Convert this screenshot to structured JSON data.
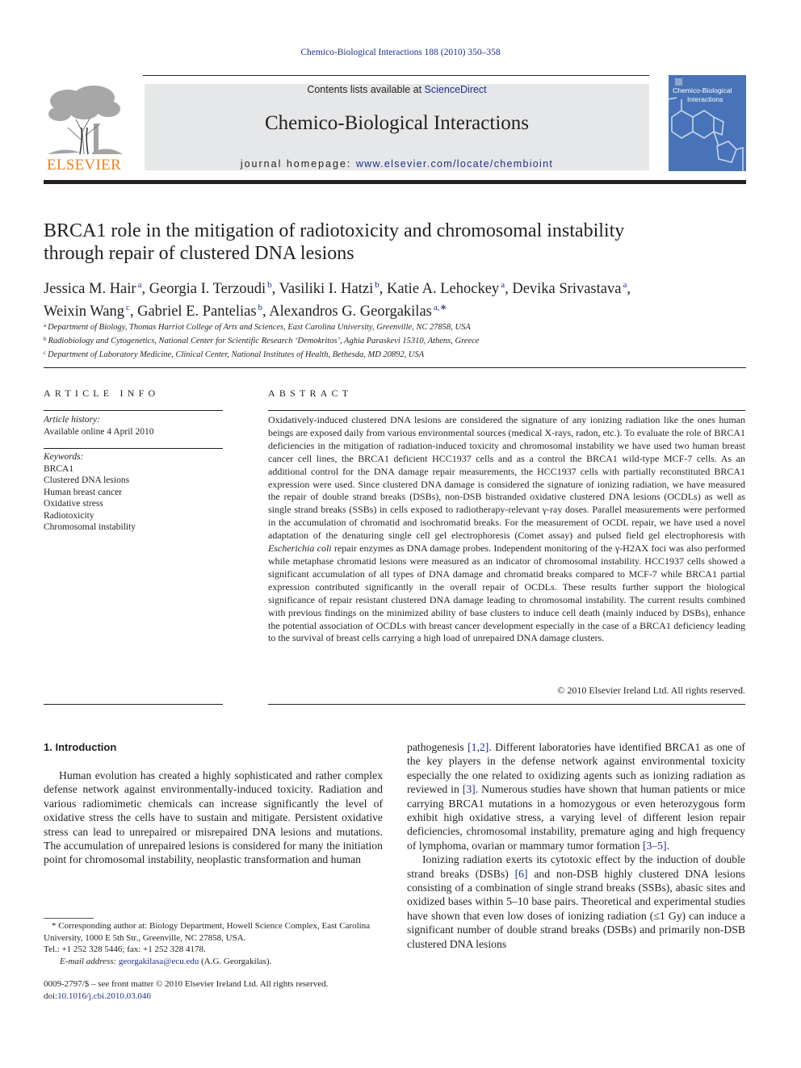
{
  "header": {
    "journal_reference": "Chemico-Biological Interactions 188 (2010) 350–358",
    "contents_prefix": "Contents lists available at ",
    "contents_link": "ScienceDirect",
    "journal_title": "Chemico-Biological Interactions",
    "homepage_prefix": "journal homepage: ",
    "homepage_link": "www.elsevier.com/locate/chembioint",
    "publisher_logo_text": "ELSEVIER",
    "cover_title_line1": "Chemico-Biological",
    "cover_title_line2": "Interactions",
    "colors": {
      "link": "#1f2f8f",
      "elsevier_orange": "#f07f18",
      "masthead_bg": "#e6e7e8",
      "cover_bg": "#4873b8"
    }
  },
  "article": {
    "title_line1": "BRCA1 role in the mitigation of radiotoxicity and chromosomal instability",
    "title_line2": "through repair of clustered DNA lesions",
    "authors": [
      {
        "name": "Jessica M. Hair",
        "aff": "a",
        "sep": ", "
      },
      {
        "name": "Georgia I. Terzoudi",
        "aff": "b",
        "sep": ", "
      },
      {
        "name": "Vasiliki I. Hatzi",
        "aff": "b",
        "sep": ", "
      },
      {
        "name": "Katie A. Lehockey",
        "aff": "a",
        "sep": ", "
      },
      {
        "name": "Devika Srivastava",
        "aff": "a",
        "sep": ","
      },
      {
        "name": "Weixin Wang",
        "aff": "c",
        "sep": ", "
      },
      {
        "name": "Gabriel E. Pantelias",
        "aff": "b",
        "sep": ", "
      },
      {
        "name": "Alexandros G. Georgakilas",
        "aff": "a,∗",
        "sep": ""
      }
    ],
    "affiliations": [
      {
        "label": "a",
        "text": "Department of Biology, Thomas Harriot College of Arts and Sciences, East Carolina University, Greenville, NC 27858, USA"
      },
      {
        "label": "b",
        "text": "Radiobiology and Cytogenetics, National Center for Scientific Research ‘Demokritos’, Aghia Paraskevi 15310, Athens, Greece"
      },
      {
        "label": "c",
        "text": "Department of Laboratory Medicine, Clinical Center, National Institutes of Health, Bethesda, MD 20892, USA"
      }
    ]
  },
  "article_info": {
    "heading": "ARTICLE INFO",
    "history_label": "Article history:",
    "history_value": "Available online 4 April 2010",
    "keywords_label": "Keywords:",
    "keywords": [
      "BRCA1",
      "Clustered DNA lesions",
      "Human breast cancer",
      "Oxidative stress",
      "Radiotoxicity",
      "Chromosomal instability"
    ]
  },
  "abstract": {
    "heading": "ABSTRACT",
    "text_part1": "Oxidatively-induced clustered DNA lesions are considered the signature of any ionizing radiation like the ones human beings are exposed daily from various environmental sources (medical X-rays, radon, etc.). To evaluate the role of BRCA1 deficiencies in the mitigation of radiation-induced toxicity and chromosomal instability we have used two human breast cancer cell lines, the BRCA1 deficient HCC1937 cells and as a control the BRCA1 wild-type MCF-7 cells. As an additional control for the DNA damage repair measurements, the HCC1937 cells with partially reconstituted BRCA1 expression were used. Since clustered DNA damage is considered the signature of ionizing radiation, we have measured the repair of double strand breaks (DSBs), non-DSB bistranded oxidative clustered DNA lesions (OCDLs) as well as single strand breaks (SSBs) in cells exposed to radiotherapy-relevant γ-ray doses. Parallel measurements were performed in the accumulation of chromatid and isochromatid breaks. For the measurement of OCDL repair, we have used a novel adaptation of the denaturing single cell gel electrophoresis (Comet assay) and pulsed field gel electrophoresis with ",
    "text_italic": "Escherichia coli",
    "text_part2": " repair enzymes as DNA damage probes. Independent monitoring of the γ-H2AX foci was also performed while metaphase chromatid lesions were measured as an indicator of chromosomal instability. HCC1937 cells showed a significant accumulation of all types of DNA damage and chromatid breaks compared to MCF-7 while BRCA1 partial expression contributed significantly in the overall repair of OCDLs. These results further support the biological significance of repair resistant clustered DNA damage leading to chromosomal instability. The current results combined with previous findings on the minimized ability of base clusters to induce cell death (mainly induced by DSBs), enhance the potential association of OCDLs with breast cancer development especially in the case of a BRCA1 deficiency leading to the survival of breast cells carrying a high load of unrepaired DNA damage clusters.",
    "copyright": "© 2010 Elsevier Ireland Ltd. All rights reserved."
  },
  "body": {
    "section_heading": "1.  Introduction",
    "left_para": "Human evolution has created a highly sophisticated and rather complex defense network against environmentally-induced toxicity. Radiation and various radiomimetic chemicals can increase significantly the level of oxidative stress the cells have to sustain and mitigate. Persistent oxidative stress can lead to unrepaired or misrepaired DNA lesions and mutations. The accumulation of unrepaired lesions is considered for many the initiation point for chromosomal instability, neoplastic transformation and human",
    "right_para1": {
      "t1": "pathogenesis ",
      "r1": "[1,2]",
      "t2": ". Different laboratories have identified BRCA1 as one of the key players in the defense network against environmental toxicity especially the one related to oxidizing agents such as ionizing radiation as reviewed in ",
      "r2": "[3]",
      "t3": ". Numerous studies have shown that human patients or mice carrying BRCA1 mutations in a homozygous or even heterozygous form exhibit high oxidative stress, a varying level of different lesion repair deficiencies, chromosomal instability, premature aging and high frequency of lymphoma, ovarian or mammary tumor formation ",
      "r3": "[3–5]",
      "t4": "."
    },
    "right_para2": {
      "t1": "Ionizing radiation exerts its cytotoxic effect by the induction of double strand breaks (DSBs) ",
      "r1": "[6]",
      "t2": " and non-DSB highly clustered DNA lesions consisting of a combination of single strand breaks (SSBs), abasic sites and oxidized bases within 5–10 base pairs. Theoretical and experimental studies have shown that even low doses of ionizing radiation (≤1 Gy) can induce a significant number of double strand breaks (DSBs) and primarily non-DSB clustered DNA lesions"
    }
  },
  "footnotes": {
    "corresponding": "* Corresponding author at: Biology Department, Howell Science Complex, East Carolina University, 1000 E 5th Str., Greenville, NC 27858, USA.",
    "tel": "Tel.: +1 252 328 5446; fax: +1 252 328 4178.",
    "email_label": "E-mail address: ",
    "email": "georgakilasa@ecu.edu",
    "email_suffix": " (A.G. Georgakilas).",
    "issn_line": "0009-2797/$ – see front matter © 2010 Elsevier Ireland Ltd. All rights reserved.",
    "doi_label": "doi:",
    "doi": "10.1016/j.cbi.2010.03.046"
  }
}
